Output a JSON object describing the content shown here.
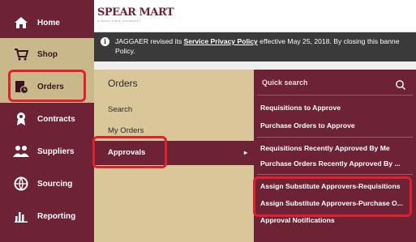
{
  "sidebar": {
    "items": [
      {
        "label": "Home",
        "icon": "home-icon"
      },
      {
        "label": "Shop",
        "icon": "cart-icon"
      },
      {
        "label": "Orders",
        "icon": "orders-icon"
      },
      {
        "label": "Contracts",
        "icon": "contracts-icon"
      },
      {
        "label": "Suppliers",
        "icon": "suppliers-icon"
      },
      {
        "label": "Sourcing",
        "icon": "sourcing-icon"
      },
      {
        "label": "Reporting",
        "icon": "reporting-icon"
      }
    ]
  },
  "header": {
    "logo": "SPEAR MART",
    "logo_sub": "FLORIDA STATE UNIVERSITY"
  },
  "banner": {
    "text_before": "JAGGAER revised its ",
    "link": "Service Privacy Policy",
    "text_after": " effective May 25, 2018. By closing this banne",
    "line2": "Policy."
  },
  "flyout": {
    "title": "Orders",
    "items": [
      "Search",
      "My Orders",
      "Approvals"
    ],
    "arrow": "▸"
  },
  "submenu": {
    "search_placeholder": "Quick search",
    "items": [
      "Requisitions to Approve",
      "Purchase Orders to Approve",
      "Requisitions Recently Approved By Me",
      "Purchase Orders Recently Approved By ...",
      "Assign Substitute Approvers-Requisitions",
      "Assign Substitute Approvers-Purchase O...",
      "Approval Notifications"
    ]
  },
  "colors": {
    "maroon": "#6e2236",
    "gold": "#d9c79a",
    "highlight": "#e0202a"
  }
}
